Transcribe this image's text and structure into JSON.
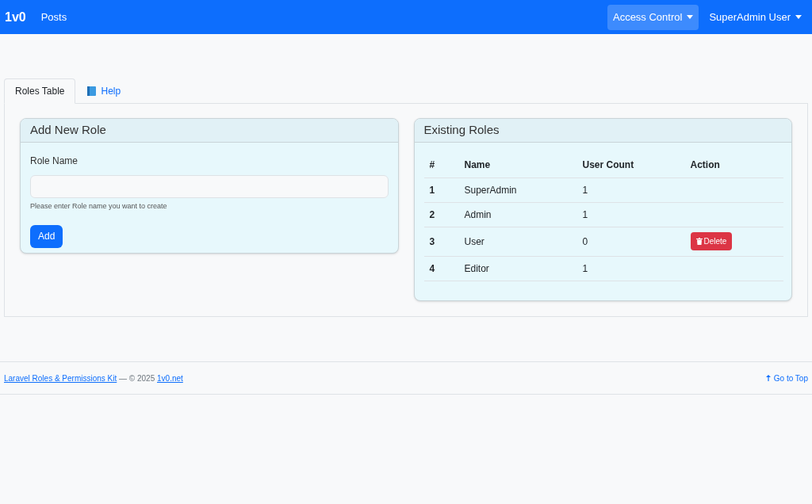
{
  "navbar": {
    "brand": "1v0",
    "links": [
      "Posts"
    ],
    "menus": [
      {
        "label": "Access Control",
        "selected": true
      },
      {
        "label": "SuperAdmin User",
        "selected": false
      }
    ]
  },
  "tabs": [
    {
      "label": "Roles Table",
      "selected": true
    },
    {
      "label": "Help",
      "selected": false
    }
  ],
  "add_role": {
    "title": "Add New Role",
    "label": "Role Name",
    "hint": "Please enter Role name you want to create",
    "button": "Add"
  },
  "existing_roles": {
    "title": "Existing Roles",
    "columns": [
      "#",
      "Name",
      "User Count",
      "Action"
    ],
    "rows": [
      {
        "index": "1",
        "name": "SuperAdmin",
        "count": "1"
      },
      {
        "index": "2",
        "name": "Admin",
        "count": "1"
      },
      {
        "index": "3",
        "name": "User",
        "count": "0",
        "action": "Delete"
      },
      {
        "index": "4",
        "name": "Editor",
        "count": "1"
      }
    ]
  },
  "footer": {
    "link": "Laravel Roles & Permissions Kit",
    "text": " — © 2025 ",
    "site": "1v0.net",
    "top": "Go to Top"
  }
}
